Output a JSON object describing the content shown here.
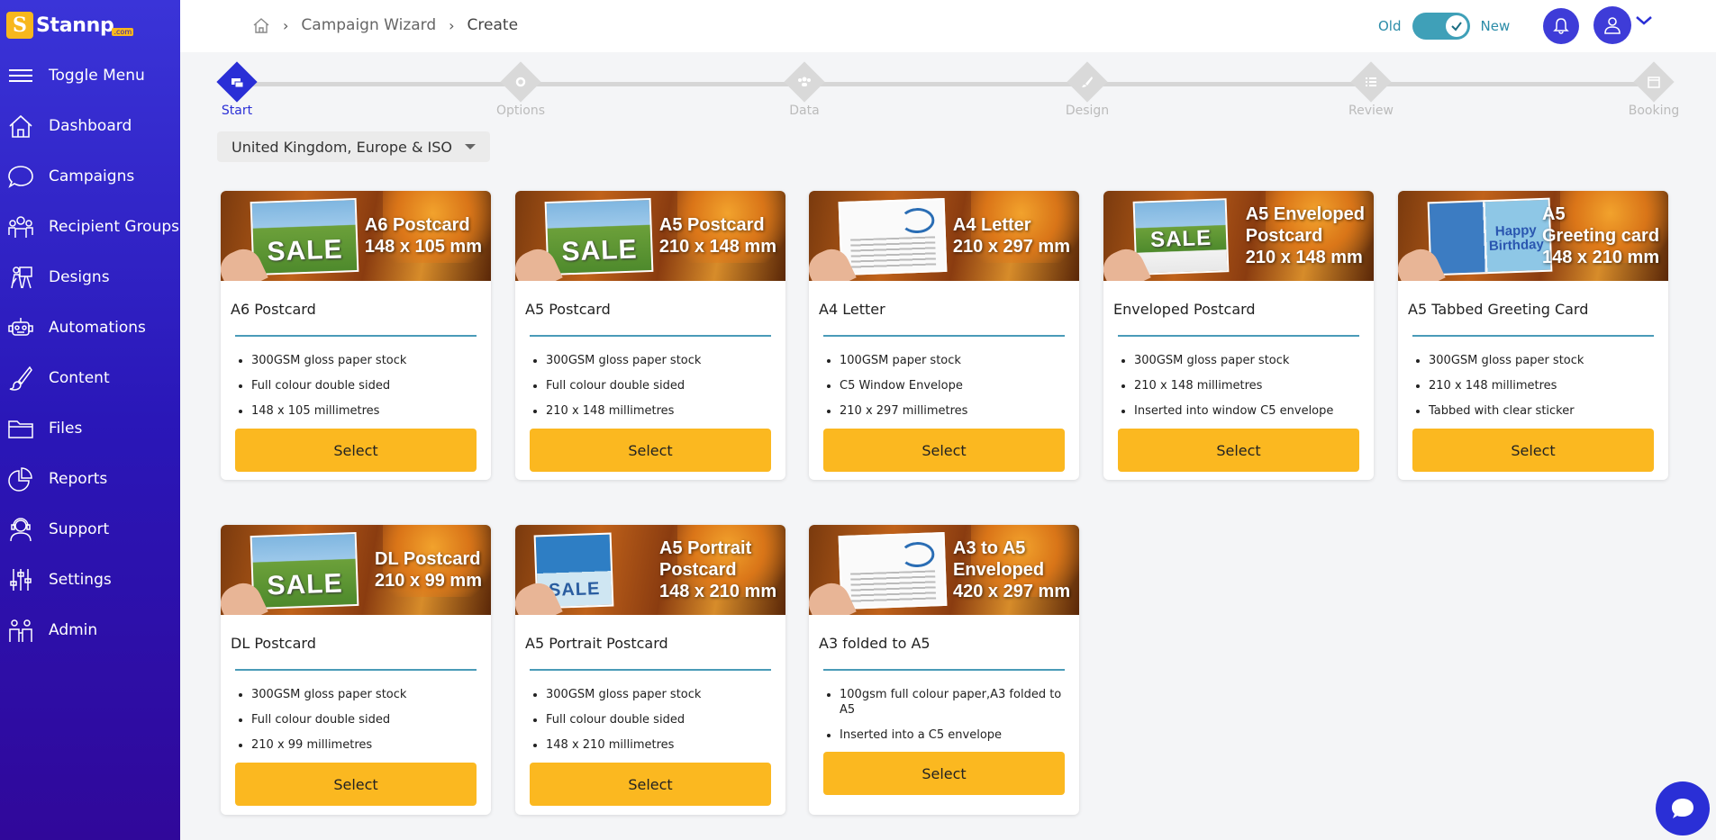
{
  "brand": {
    "name": "Stannp",
    "suffix": ".com"
  },
  "sidebar": {
    "items": [
      {
        "label": "Toggle Menu",
        "icon": "menu-icon"
      },
      {
        "label": "Dashboard",
        "icon": "home-icon"
      },
      {
        "label": "Campaigns",
        "icon": "chat-bubble-icon"
      },
      {
        "label": "Recipient Groups",
        "icon": "group-icon"
      },
      {
        "label": "Designs",
        "icon": "easel-icon"
      },
      {
        "label": "Automations",
        "icon": "robot-icon"
      },
      {
        "label": "Content",
        "icon": "brush-icon"
      },
      {
        "label": "Files",
        "icon": "folder-icon"
      },
      {
        "label": "Reports",
        "icon": "pie-chart-icon"
      },
      {
        "label": "Support",
        "icon": "support-agent-icon"
      },
      {
        "label": "Settings",
        "icon": "sliders-icon"
      },
      {
        "label": "Admin",
        "icon": "admin-users-icon"
      }
    ]
  },
  "breadcrumb": {
    "home_icon": "home-icon",
    "items": [
      "Campaign Wizard",
      "Create"
    ]
  },
  "header": {
    "toggle_old": "Old",
    "toggle_new": "New",
    "toggle_state": "New"
  },
  "stepper": {
    "steps": [
      {
        "label": "Start",
        "active": true
      },
      {
        "label": "Options",
        "active": false
      },
      {
        "label": "Data",
        "active": false
      },
      {
        "label": "Design",
        "active": false
      },
      {
        "label": "Review",
        "active": false
      },
      {
        "label": "Booking",
        "active": false
      }
    ]
  },
  "region": {
    "selected": "United Kingdom, Europe & ISO"
  },
  "colors": {
    "sidebar": "#2a17b8",
    "accent": "#2a2fd6",
    "button": "#fbb820",
    "divider": "#4a9bb8",
    "toggle": "#3fa0b8"
  },
  "cards": [
    {
      "banner_line1": "A6 Postcard",
      "banner_line2": "148 x 105 mm",
      "banner_line3": "",
      "title": "A6 Postcard",
      "features": [
        "300GSM gloss paper stock",
        "Full colour double sided",
        "148 x 105 millimetres"
      ],
      "button": "Select",
      "image": "SALE"
    },
    {
      "banner_line1": "A5 Postcard",
      "banner_line2": "210 x 148 mm",
      "banner_line3": "",
      "title": "A5 Postcard",
      "features": [
        "300GSM gloss paper stock",
        "Full colour double sided",
        "210 x 148 millimetres"
      ],
      "button": "Select",
      "image": "SALE"
    },
    {
      "banner_line1": "A4 Letter",
      "banner_line2": "210 x 297 mm",
      "banner_line3": "",
      "title": "A4 Letter",
      "features": [
        "100GSM paper stock",
        "C5 Window Envelope",
        "210 x 297 millimetres"
      ],
      "button": "Select",
      "image": ""
    },
    {
      "banner_line1": "A5 Enveloped",
      "banner_line2": "Postcard",
      "banner_line3": "210 x 148 mm",
      "title": "Enveloped Postcard",
      "features": [
        "300GSM gloss paper stock",
        "210 x 148 millimetres",
        "Inserted into window C5 envelope"
      ],
      "button": "Select",
      "image": "SALE"
    },
    {
      "banner_line1": "A5",
      "banner_line2": "Greeting card",
      "banner_line3": "148 x 210 mm",
      "title": "A5 Tabbed Greeting Card",
      "features": [
        "300GSM gloss paper stock",
        "210 x 148 millimetres",
        "Tabbed with clear sticker"
      ],
      "button": "Select",
      "image": "Happy Birthday"
    },
    {
      "banner_line1": "DL Postcard",
      "banner_line2": "210 x 99 mm",
      "banner_line3": "",
      "title": "DL Postcard",
      "features": [
        "300GSM gloss paper stock",
        "Full colour double sided",
        "210 x 99 millimetres"
      ],
      "button": "Select",
      "image": "SALE"
    },
    {
      "banner_line1": "A5 Portrait",
      "banner_line2": "Postcard",
      "banner_line3": "148 x 210 mm",
      "title": "A5 Portrait Postcard",
      "features": [
        "300GSM gloss paper stock",
        "Full colour double sided",
        "148 x 210 millimetres"
      ],
      "button": "Select",
      "image": "SALE"
    },
    {
      "banner_line1": "A3 to A5",
      "banner_line2": "Enveloped",
      "banner_line3": "420 x 297 mm",
      "title": "A3 folded to A5",
      "features": [
        "100gsm full colour paper,A3 folded to A5",
        "Inserted into a C5 envelope"
      ],
      "button": "Select",
      "image": ""
    }
  ]
}
